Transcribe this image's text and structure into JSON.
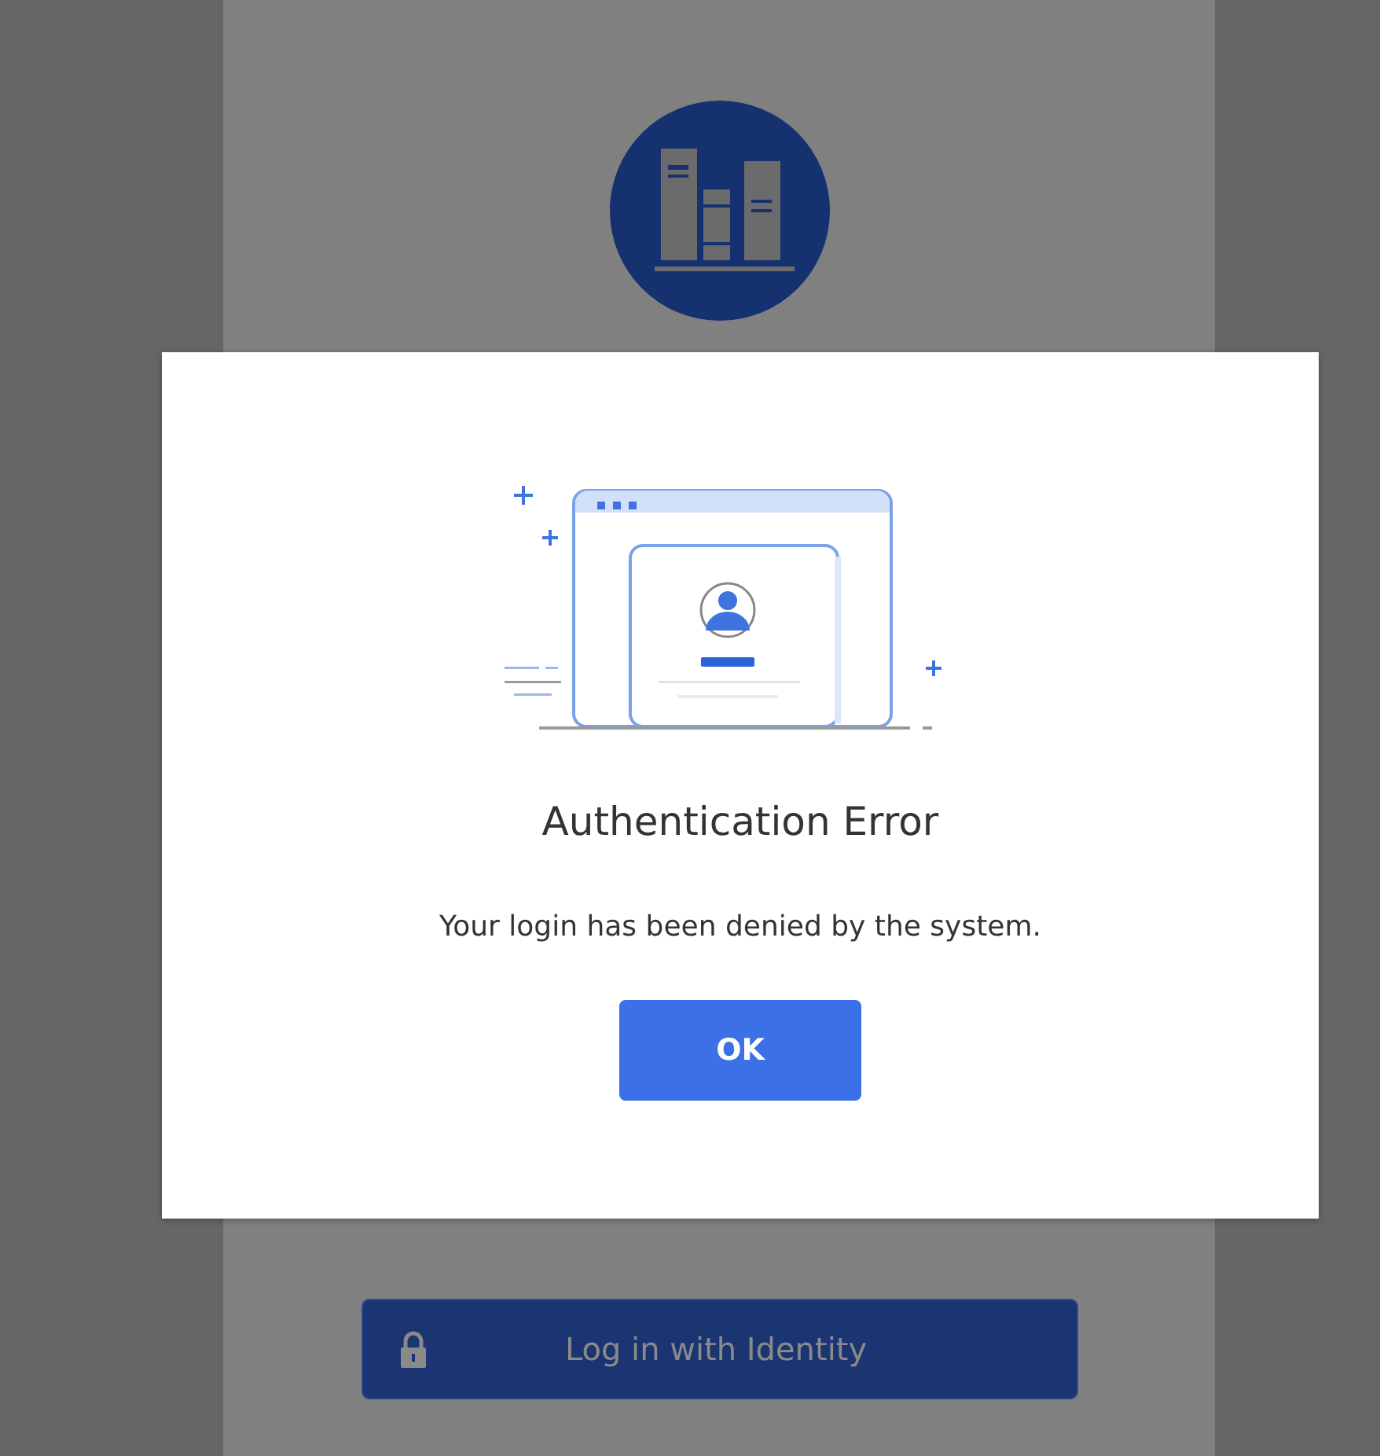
{
  "dialog": {
    "title": "Authentication Error",
    "message": "Your login has been denied by the system.",
    "button": "OK"
  },
  "login": {
    "button": "Log in with Identity"
  }
}
